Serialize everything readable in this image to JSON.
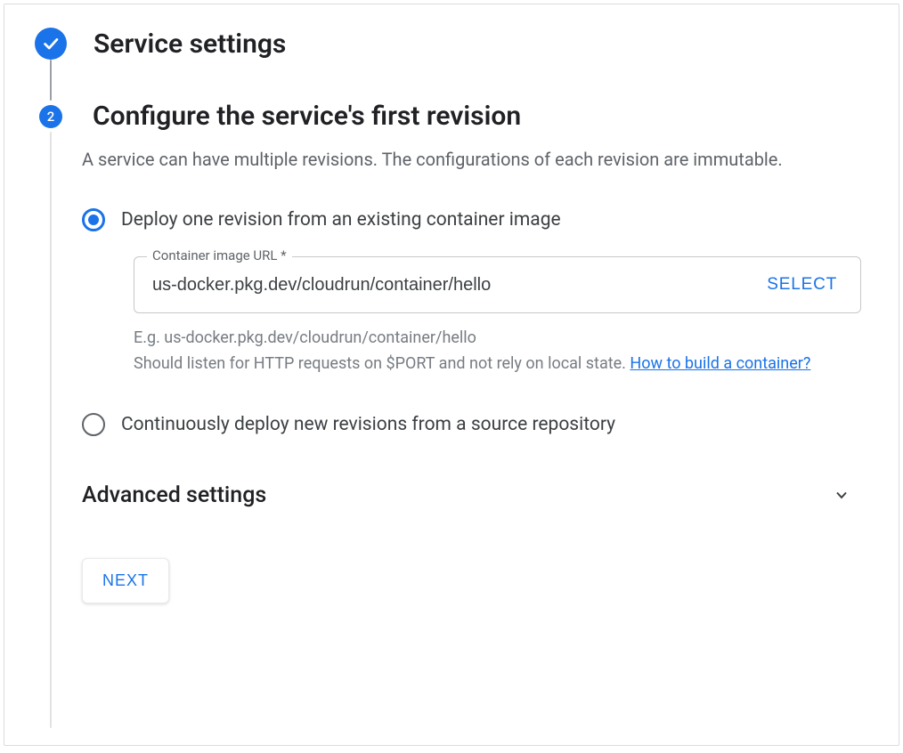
{
  "step1": {
    "title": "Service settings"
  },
  "step2": {
    "number": "2",
    "title": "Configure the service's first revision",
    "description": "A service can have multiple revisions. The configurations of each revision are immutable.",
    "options": {
      "existing_image_label": "Deploy one revision from an existing container image",
      "continuous_label": "Continuously deploy new revisions from a source repository"
    },
    "field": {
      "label": "Container image URL *",
      "value": "us-docker.pkg.dev/cloudrun/container/hello",
      "select_button": "SELECT",
      "hint_prefix": "E.g. us-docker.pkg.dev/cloudrun/container/hello",
      "hint_body": "Should listen for HTTP requests on $PORT and not rely on local state. ",
      "hint_link": "How to build a container?"
    },
    "advanced": {
      "title": "Advanced settings"
    },
    "next_button": "NEXT"
  }
}
